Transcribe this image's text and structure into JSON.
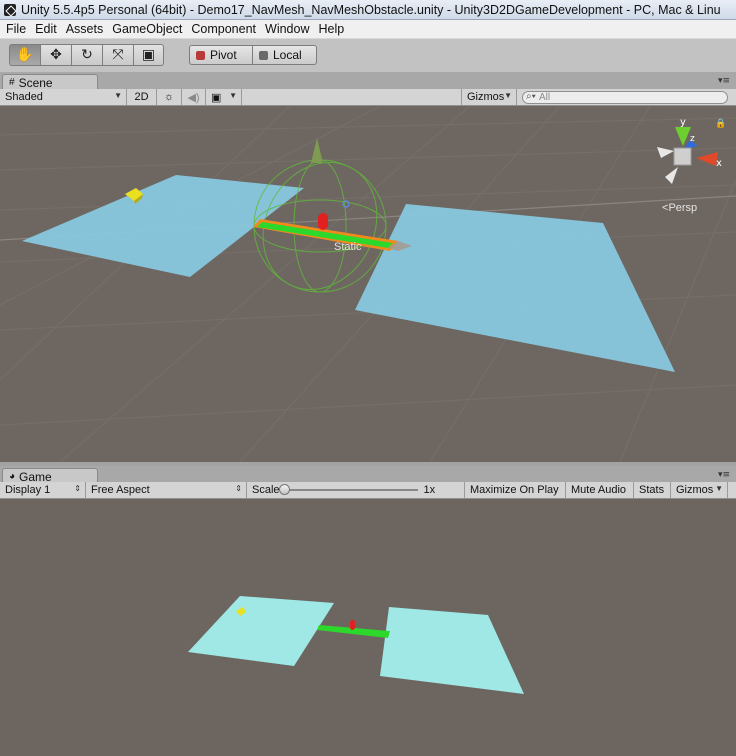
{
  "window": {
    "title": "Unity 5.5.4p5 Personal (64bit) - Demo17_NavMesh_NavMeshObstacle.unity - Unity3D2DGameDevelopment - PC, Mac & Linu"
  },
  "menu": {
    "items": [
      "File",
      "Edit",
      "Assets",
      "GameObject",
      "Component",
      "Window",
      "Help"
    ]
  },
  "toolbar": {
    "tools": [
      {
        "name": "hand-tool",
        "glyph": "✋"
      },
      {
        "name": "move-tool",
        "glyph": "✥"
      },
      {
        "name": "rotate-tool",
        "glyph": "↻"
      },
      {
        "name": "scale-tool",
        "glyph": "⤧"
      },
      {
        "name": "rect-tool",
        "glyph": "▣"
      }
    ],
    "pivot_label": "Pivot",
    "local_label": "Local"
  },
  "scene": {
    "tab_label": "Scene",
    "shading_mode": "Shaded",
    "mode_2d": "2D",
    "gizmos_label": "Gizmos",
    "search_placeholder": "All",
    "static_label": "Static",
    "persp_label": "Persp",
    "axis_x": "x",
    "axis_y": "y",
    "axis_z": "z"
  },
  "game": {
    "tab_label": "Game",
    "display": "Display 1",
    "aspect": "Free Aspect",
    "scale_label": "Scale",
    "scale_value": "1x",
    "maximize_label": "Maximize On Play",
    "mute_label": "Mute Audio",
    "stats_label": "Stats",
    "gizmos_label": "Gizmos"
  },
  "colors": {
    "plane": "#88c8de",
    "game_plane": "#9fe8e6",
    "obstacle": "#2bd82b",
    "selection_outline": "#f08a1c",
    "agent": "#e32020",
    "background": "#6e6761"
  }
}
